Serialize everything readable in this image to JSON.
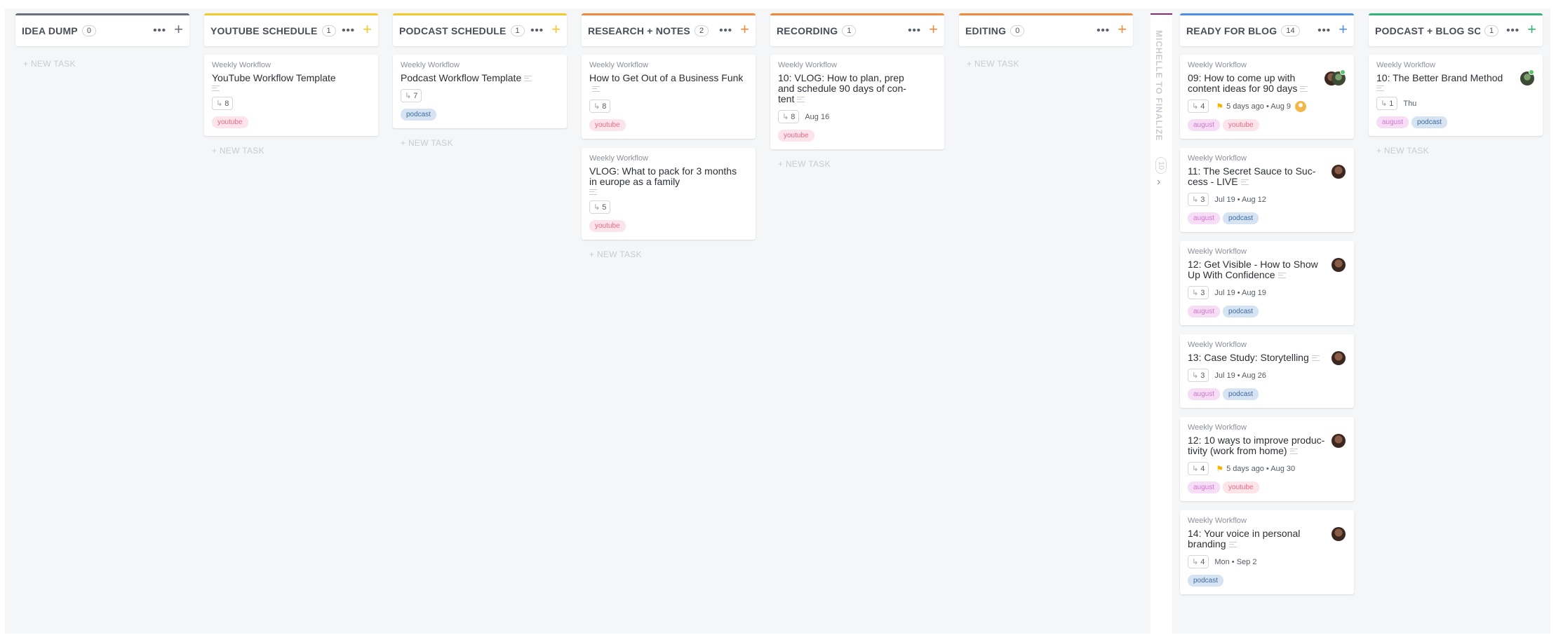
{
  "common": {
    "workflow": "Weekly Workflow",
    "new_task": "+ NEW TASK"
  },
  "columns": [
    {
      "title": "IDEA DUMP",
      "count": "0",
      "color": "#6b6f7b"
    },
    {
      "title": "YOUTUBE SCHEDULE",
      "count": "1",
      "color": "#f4c82a"
    },
    {
      "title": "PODCAST SCHEDULE",
      "count": "1",
      "color": "#f4c82a"
    },
    {
      "title": "RESEARCH + NOTES",
      "count": "2",
      "color": "#f08a3c"
    },
    {
      "title": "RECORDING",
      "count": "1",
      "color": "#f08a3c"
    },
    {
      "title": "EDITING",
      "count": "0",
      "color": "#f08a3c"
    },
    {
      "title": "READY FOR BLOG",
      "count": "14",
      "color": "#4f8fe8"
    },
    {
      "title": "PODCAST + BLOG SC...",
      "count": "1",
      "color": "#34b27a"
    }
  ],
  "collapsed": {
    "title": "MICHELLE TO FINALIZE",
    "count": "10",
    "color": "#8a2c6a"
  },
  "tasks": {
    "yt1": {
      "title": "YouTube Workflow Template",
      "sub": "8",
      "tags": [
        "youtube"
      ]
    },
    "pc1": {
      "title": "Podcast Workflow Template",
      "sub": "7",
      "tags": [
        "podcast"
      ]
    },
    "rn1": {
      "title": "How to Get Out of a Business Funk",
      "sub": "8",
      "tags": [
        "youtube"
      ]
    },
    "rn2": {
      "title": "VLOG: What to pack for 3 months in europe as a family",
      "sub": "5",
      "tags": [
        "youtube"
      ]
    },
    "rec1": {
      "title": "10: VLOG: How to plan, prep and schedule 90 days of con-tent",
      "sub": "8",
      "dates": "Aug 16",
      "tags": [
        "youtube"
      ]
    },
    "rb1": {
      "title": "09: How to come up with content ideas for 90 days",
      "sub": "4",
      "dates": "5 days ago  •  Aug 9",
      "tags": [
        "august",
        "youtube"
      ]
    },
    "rb2": {
      "title": "11: The Secret Sauce to Suc-cess - LIVE",
      "sub": "3",
      "dates": "Jul 19  •  Aug 12",
      "tags": [
        "august",
        "podcast"
      ]
    },
    "rb3": {
      "title": "12: Get Visible - How to Show Up With Confidence",
      "sub": "3",
      "dates": "Jul 19  •  Aug 19",
      "tags": [
        "august",
        "podcast"
      ]
    },
    "rb4": {
      "title": "13: Case Study: Storytelling",
      "sub": "3",
      "dates": "Jul 19  •  Aug 26",
      "tags": [
        "august",
        "podcast"
      ]
    },
    "rb5": {
      "title": "12: 10 ways to improve produc-tivity (work from home)",
      "sub": "4",
      "dates": "5 days ago  •  Aug 30",
      "tags": [
        "august",
        "youtube"
      ]
    },
    "rb6": {
      "title": "14: Your voice in personal branding",
      "sub": "4",
      "dates": "Mon  •  Sep 2",
      "tags": [
        "podcast"
      ]
    },
    "pb1": {
      "title": "10: The Better Brand Method",
      "sub": "1",
      "dates": "Thu",
      "tags": [
        "august",
        "podcast"
      ]
    }
  }
}
